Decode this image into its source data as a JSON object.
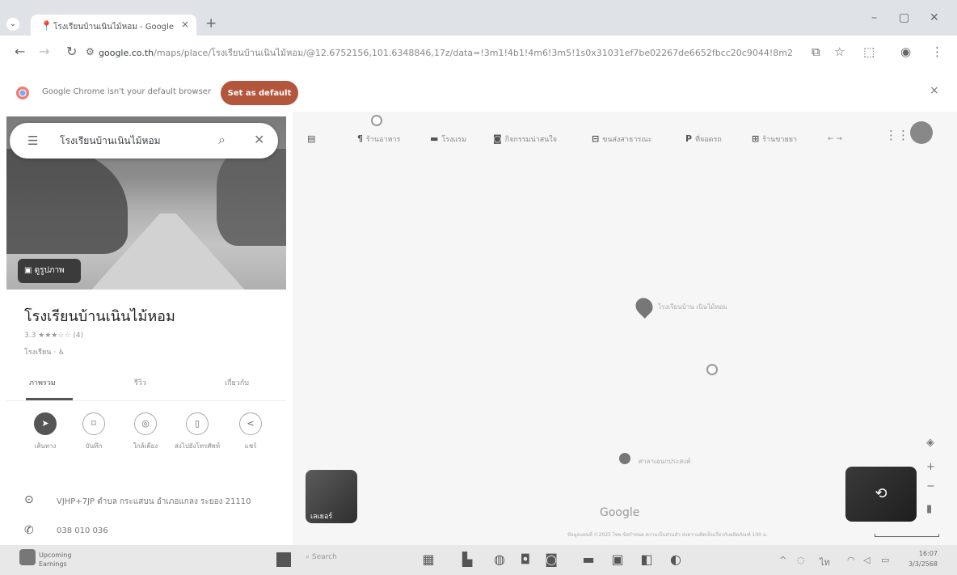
{
  "browser": {
    "tab_title": "โรงเรียนบ้านเนินไม้หอม - Google",
    "url_host": "google.co.th",
    "url_path": "/maps/place/โรงเรียนบ้านเนินไม้หอม/@12.6752156,101.6348846,17z/data=!3m1!4b1!4m6!3m5!1s0x31031ef7be02267de6652fbcc20c9044!8m2!3d...",
    "infobar_message": "Google Chrome isn't your default browser",
    "infobar_button": "Set as default"
  },
  "panel": {
    "search_value": "โรงเรียนบ้านเนินไม้หอม",
    "photo_chip": "ดูรูปภาพ",
    "title": "โรงเรียนบ้านเนินไม้หอม",
    "rating": "3.3 ★★★☆☆ (4)",
    "category": "โรงเรียน · ♿",
    "tabs": [
      "ภาพรวม",
      "รีวิว",
      "เกี่ยวกับ"
    ],
    "actions": [
      "เส้นทาง",
      "บันทึก",
      "ใกล้เคียง",
      "ส่งไปยังโทรศัพท์",
      "แชร์"
    ],
    "address": "VJHP+7JP ตำบล กระแสบน อำเภอแกลง ระยอง 21110",
    "phone": "038 010 036"
  },
  "map": {
    "chips": [
      "ร้านอาหาร",
      "โรงแรม",
      "กิจกรรมน่าสนใจ",
      "ขนส่งสาธารณะ",
      "ที่จอดรถ",
      "ร้านขายยา"
    ],
    "pin_label": "โรงเรียนบ้าน เนินไม้หอม",
    "poi_label": "ศาลาเอนกประสงค์",
    "layers_label": "เลเยอร์",
    "watermark": "Google",
    "footer": "ข้อมูลแผนที่ ©2025   ไทย   ข้อกำหนด   ความเป็นส่วนตัว   ส่งความคิดเห็นเกี่ยวกับผลิตภัณฑ์   100 ม."
  },
  "taskbar": {
    "weather_title": "Upcoming",
    "weather_sub": "Earnings",
    "search_placeholder": "Search",
    "time": "16:07",
    "date": "3/3/2568"
  }
}
